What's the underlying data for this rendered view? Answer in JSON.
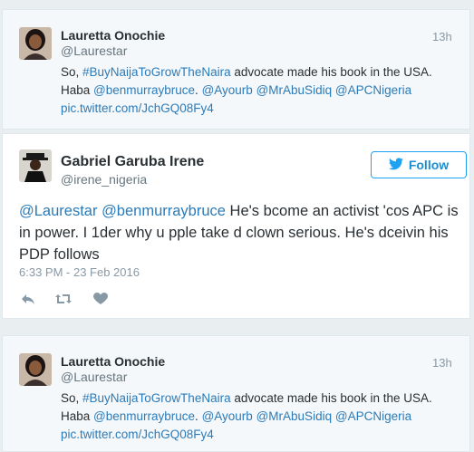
{
  "parent_tweet": {
    "name": "Lauretta Onochie",
    "handle": "@Laurestar",
    "time": "13h",
    "text_before": "So, ",
    "hashtag": "#BuyNaijaToGrowTheNaira",
    "text_after": " advocate made his book in the USA.",
    "line2_prefix": "Haba ",
    "mentions": [
      "@benmurraybruce",
      ".",
      "@Ayourb",
      "@MrAbuSidiq",
      "@APCNigeria"
    ],
    "pic_link": "pic.twitter.com/JchGQ08Fy4"
  },
  "main_tweet": {
    "name": "Gabriel Garuba Irene",
    "handle": "@irene_nigeria",
    "follow_label": "Follow",
    "mention1": "@Laurestar",
    "mention2": "@benmurraybruce",
    "text": " He's bcome an activist 'cos APC is in power. I 1der why u pple take d clown serious. He's dceivin his PDP follows",
    "timestamp": "6:33 PM - 23 Feb 2016"
  },
  "colors": {
    "link": "#2b7bb9",
    "follow_border": "#1da1f2",
    "follow_text": "#1d8dd2"
  },
  "icons": [
    "reply-icon",
    "retweet-icon",
    "like-icon",
    "twitter-bird-icon"
  ]
}
